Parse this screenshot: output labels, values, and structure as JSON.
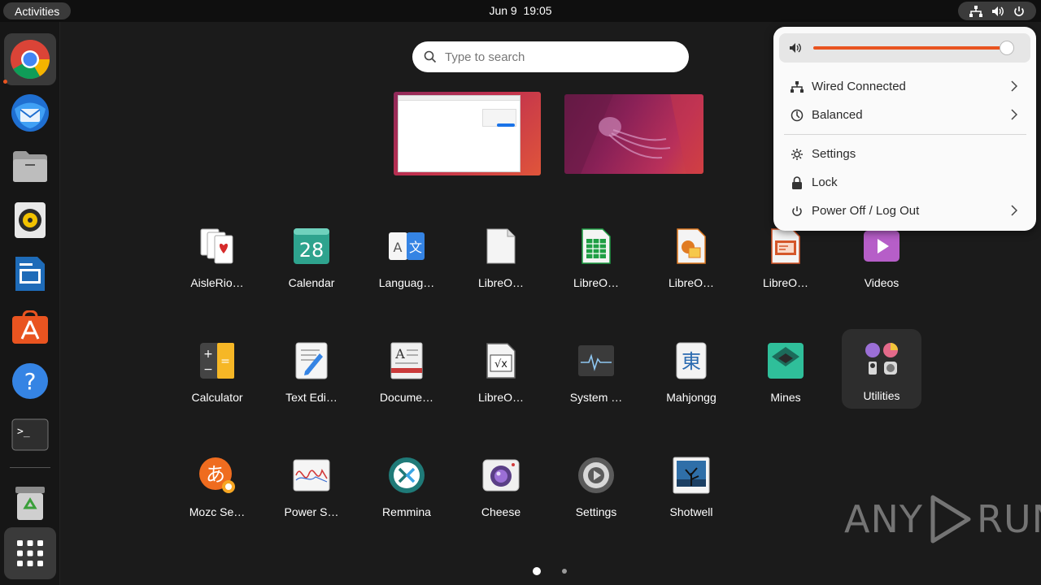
{
  "topbar": {
    "activities": "Activities",
    "date": "Jun 9",
    "time": "19:05"
  },
  "dock": {
    "items": [
      {
        "name": "Google Chrome",
        "icon": "chrome-icon"
      },
      {
        "name": "Thunderbird",
        "icon": "thunderbird-icon"
      },
      {
        "name": "Files",
        "icon": "files-icon"
      },
      {
        "name": "Rhythmbox",
        "icon": "rhythmbox-icon"
      },
      {
        "name": "LibreOffice Writer",
        "icon": "writer-icon"
      },
      {
        "name": "Ubuntu Software",
        "icon": "software-icon"
      },
      {
        "name": "Help",
        "icon": "help-icon",
        "glyph": "?"
      },
      {
        "name": "Terminal",
        "icon": "terminal-icon",
        "glyph": ">_"
      },
      {
        "name": "Trash",
        "icon": "trash-icon"
      },
      {
        "name": "Show Applications",
        "icon": "app-grid-icon"
      }
    ]
  },
  "search": {
    "placeholder": "Type to search"
  },
  "apps": [
    {
      "label": "AisleRio…",
      "icon": "aisleriot-icon"
    },
    {
      "label": "Calendar",
      "icon": "calendar-icon",
      "glyph": "28"
    },
    {
      "label": "Languag…",
      "icon": "language-icon",
      "glyph_a": "A",
      "glyph_b": "文"
    },
    {
      "label": "LibreO…",
      "icon": "libreoffice-icon"
    },
    {
      "label": "LibreO…",
      "icon": "libreoffice-calc-icon"
    },
    {
      "label": "LibreO…",
      "icon": "libreoffice-draw-icon"
    },
    {
      "label": "LibreO…",
      "icon": "libreoffice-impress-icon"
    },
    {
      "label": "Videos",
      "icon": "videos-icon"
    },
    {
      "label": "Calculator",
      "icon": "calculator-icon"
    },
    {
      "label": "Text Edi…",
      "icon": "text-editor-icon"
    },
    {
      "label": "Docume…",
      "icon": "document-viewer-icon",
      "glyph": "A"
    },
    {
      "label": "LibreO…",
      "icon": "libreoffice-math-icon",
      "glyph": "√x"
    },
    {
      "label": "System …",
      "icon": "system-monitor-icon"
    },
    {
      "label": "Mahjongg",
      "icon": "mahjongg-icon",
      "glyph": "東"
    },
    {
      "label": "Mines",
      "icon": "mines-icon"
    },
    {
      "label": "Utilities",
      "icon": "utilities-folder-icon"
    },
    {
      "label": "Mozc Se…",
      "icon": "mozc-icon",
      "glyph": "あ"
    },
    {
      "label": "Power S…",
      "icon": "power-statistics-icon"
    },
    {
      "label": "Remmina",
      "icon": "remmina-icon"
    },
    {
      "label": "Cheese",
      "icon": "cheese-icon"
    },
    {
      "label": "Settings",
      "icon": "settings-icon"
    },
    {
      "label": "Shotwell",
      "icon": "shotwell-icon"
    }
  ],
  "pager": {
    "pages": 2,
    "current": 1
  },
  "quick_settings": {
    "volume_level": 0.97,
    "items": [
      {
        "label": "Wired Connected",
        "icon": "network-wired-icon",
        "has_submenu": true
      },
      {
        "label": "Balanced",
        "icon": "power-profile-icon",
        "has_submenu": true
      },
      {
        "label": "Settings",
        "icon": "gear-icon",
        "has_submenu": false
      },
      {
        "label": "Lock",
        "icon": "lock-icon",
        "has_submenu": false
      },
      {
        "label": "Power Off / Log Out",
        "icon": "power-icon",
        "has_submenu": true
      }
    ]
  },
  "watermark": {
    "left": "ANY",
    "right": "RUN"
  },
  "colors": {
    "accent": "#e95420",
    "panel": "#fafafa",
    "background": "#1d1d1d"
  }
}
